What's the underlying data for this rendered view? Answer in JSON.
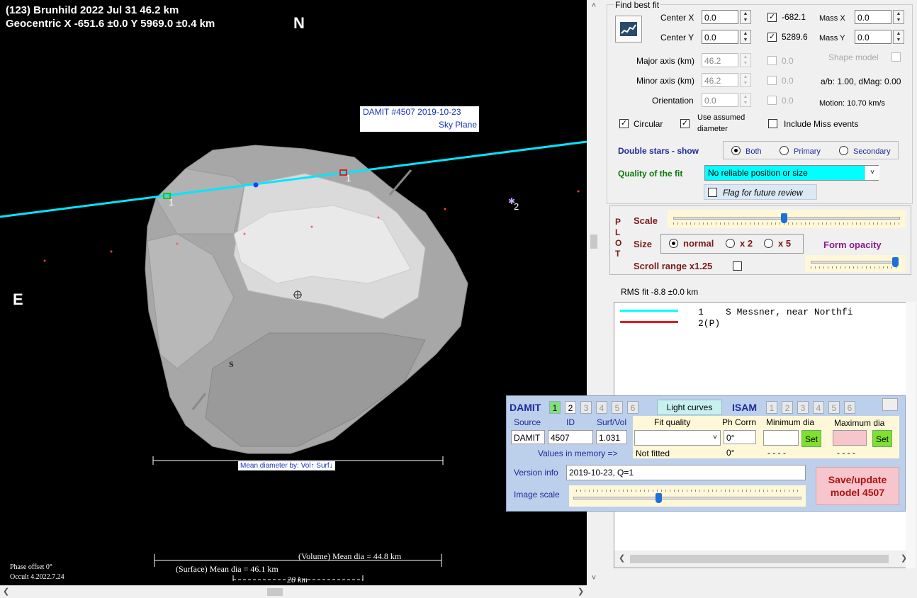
{
  "plot": {
    "title_line1": "(123) Brunhild  2022 Jul 31   46.2 km",
    "title_line2": "Geocentric X  -651.6 ±0.0  Y 5969.0 ±0.4 km",
    "north": "N",
    "east": "E",
    "damit_label_line1": "DAMIT #4507 2019-10-23",
    "damit_label_line2": "Sky Plane",
    "chord_1_label": "1",
    "chord_1b_label": "1",
    "chord_2_label": "2",
    "south_marker": "S",
    "mean_dia_box": "Mean diameter by: Vol↑ Surf↓",
    "volume_mean": "(Volume) Mean dia = 44.8 km",
    "surface_mean": "(Surface) Mean dia = 46.1 km",
    "scale_label": "20 km",
    "phase_offset": "Phase offset 0°",
    "version": "Occult 4.2022.7.24"
  },
  "fit": {
    "group_label": "Find best fit",
    "center_x_label": "Center X",
    "center_x_value": "0.0",
    "center_y_label": "Center Y",
    "center_y_value": "0.0",
    "x_check_value": "-682.1",
    "y_check_value": "5289.6",
    "mass_x_label": "Mass X",
    "mass_x_value": "0.0",
    "mass_y_label": "Mass Y",
    "mass_y_value": "0.0",
    "major_label": "Major axis (km)",
    "major_value": "46.2",
    "minor_label": "Minor axis (km)",
    "minor_value": "46.2",
    "orient_label": "Orientation",
    "orient_value": "0.0",
    "major_check_value": "0.0",
    "minor_check_value": "0.0",
    "orient_check_value": "0.0",
    "shape_model_label": "Shape model",
    "ab_text": "a/b: 1.00, dMag: 0.00",
    "motion_text": "Motion: 10.70 km/s",
    "circular_label": "Circular",
    "assumed_label_1": "Use assumed",
    "assumed_label_2": "diameter",
    "miss_label": "Include Miss events",
    "double_label": "Double stars - show",
    "both_label": "Both",
    "primary_label": "Primary",
    "secondary_label": "Secondary",
    "quality_label": "Quality of the fit",
    "quality_value": "No reliable position or size",
    "flag_label": "Flag for future review"
  },
  "plotctl": {
    "plot_letters": [
      "P",
      "L",
      "O",
      "T"
    ],
    "scale_label": "Scale",
    "size_label": "Size",
    "normal_label": "normal",
    "x2_label": "x 2",
    "x5_label": "x 5",
    "opacity_label": "Form opacity",
    "scroll_label": "Scroll range x1.25",
    "scale_slider_fraction": 0.49,
    "opacity_slider_fraction": 1.0
  },
  "rms": "RMS fit -8.8 ±0.0 km",
  "legend": {
    "line1": "1    S Messner, near Northfi",
    "line2": "2(P)",
    "color1": "#00ffff",
    "color2": "#e02020"
  },
  "damit": {
    "title": "DAMIT",
    "tabs": [
      "1",
      "2",
      "3",
      "4",
      "5",
      "6"
    ],
    "light_curves": "Light curves",
    "isam": "ISAM",
    "isam_tabs": [
      "1",
      "2",
      "3",
      "4",
      "5",
      "6"
    ],
    "col_source": "Source",
    "col_id": "ID",
    "col_surfvol": "Surf/Vol",
    "col_fitq": "Fit quality",
    "col_phcorr": "Ph Corrn",
    "col_mindia": "Minimum dia",
    "col_maxdia": "Maximum dia",
    "source_value": "DAMIT",
    "id_value": "4507",
    "surfvol_value": "1.031",
    "phcorr_value": "0°",
    "set_label": "Set",
    "memory_label": "Values in memory =>",
    "not_fitted": "Not fitted",
    "mem_ph": "0°",
    "dashes1": "- - - -",
    "dashes2": "- - - -",
    "version_label": "Version info",
    "version_value": "2019-10-23, Q=1",
    "image_scale_label": "Image scale",
    "image_scale_fraction": 0.37,
    "save_line1": "Save/update",
    "save_line2": "model 4507"
  },
  "colors": {
    "quality_bg": "#00ffff",
    "damit_bg": "#bcd0ec",
    "save_bg": "#f7c6cc",
    "set_bg": "#7fe030",
    "highlight_bg": "#fff8d8"
  }
}
